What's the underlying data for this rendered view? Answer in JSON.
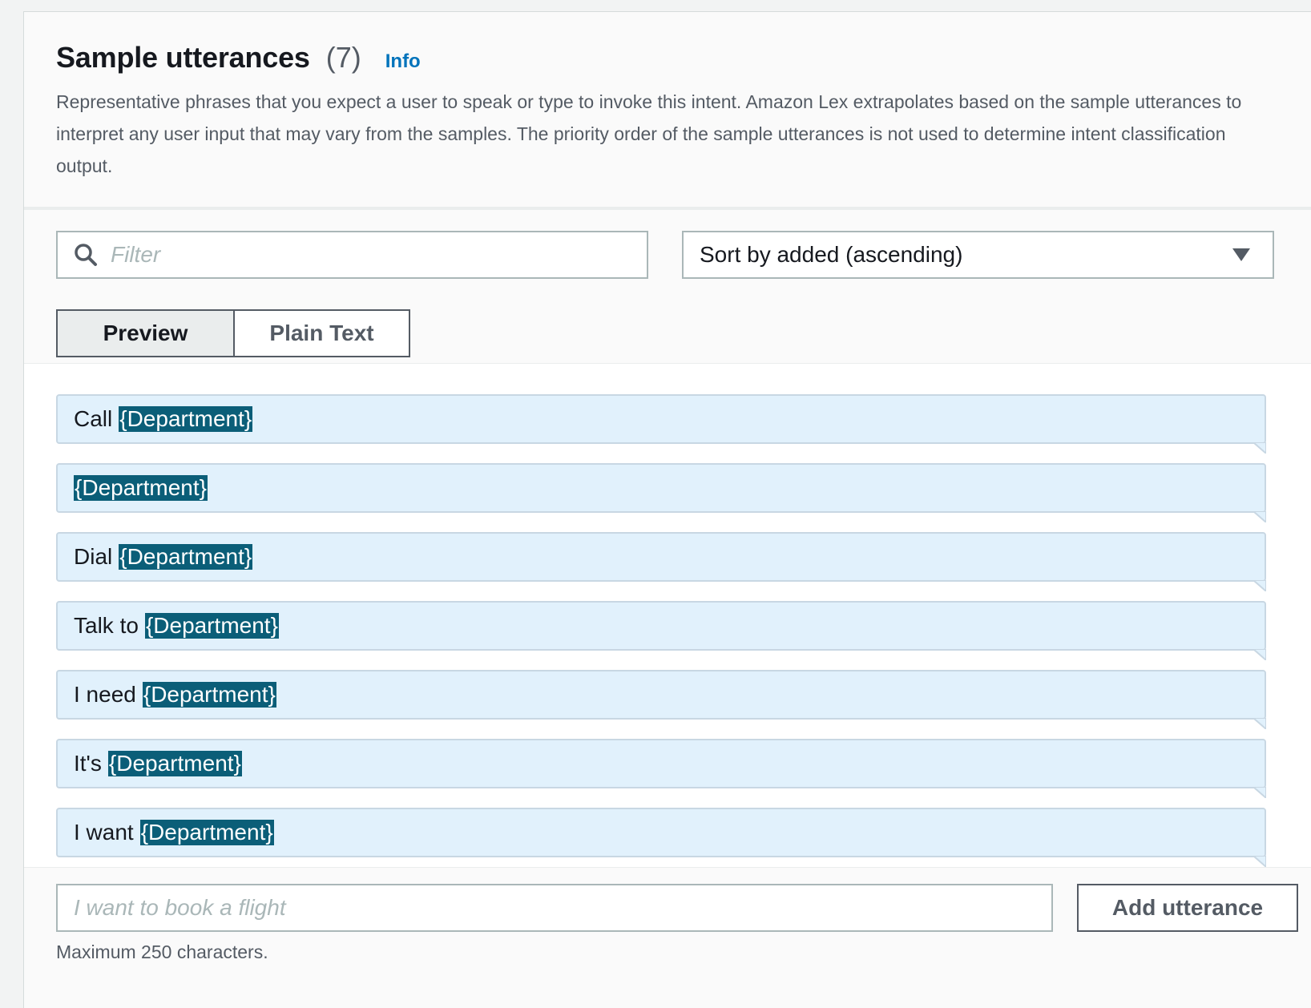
{
  "header": {
    "title": "Sample utterances",
    "count": "(7)",
    "info_link": "Info",
    "description": "Representative phrases that you expect a user to speak or type to invoke this intent. Amazon Lex extrapolates based on the sample utterances to interpret any user input that may vary from the samples. The priority order of the sample utterances is not used to determine intent classification output."
  },
  "filter": {
    "placeholder": "Filter",
    "icon": "search-icon"
  },
  "sort": {
    "selected": "Sort by added (ascending)",
    "icon": "caret-down-icon"
  },
  "view_toggle": {
    "preview_label": "Preview",
    "plain_text_label": "Plain Text",
    "active": "Preview"
  },
  "utterances": [
    {
      "prefix": "Call",
      "slot": "{Department}"
    },
    {
      "prefix": "",
      "slot": "{Department}"
    },
    {
      "prefix": "Dial",
      "slot": "{Department}"
    },
    {
      "prefix": "Talk to",
      "slot": "{Department}"
    },
    {
      "prefix": "I need",
      "slot": "{Department}"
    },
    {
      "prefix": "It's",
      "slot": "{Department}"
    },
    {
      "prefix": "I want",
      "slot": "{Department}"
    }
  ],
  "footer": {
    "input_placeholder": "I want to book a flight",
    "add_button_label": "Add utterance",
    "hint": "Maximum 250 characters."
  },
  "colors": {
    "utterance_bg": "#e1f1fc",
    "slot_bg": "#0b5e78",
    "link": "#0073bb"
  }
}
